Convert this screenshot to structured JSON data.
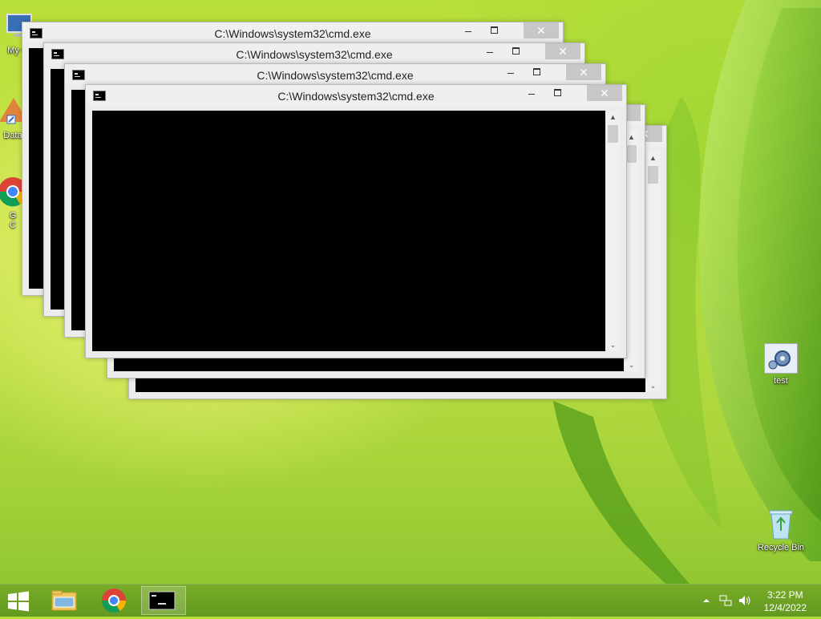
{
  "desktop": {
    "icons": [
      {
        "label": "My C",
        "name": "my-computer"
      },
      {
        "label": "Data",
        "name": "data-shortcut"
      },
      {
        "label": "G",
        "label2": "C",
        "name": "google-chrome"
      },
      {
        "label": "test",
        "name": "test"
      },
      {
        "label": "Recycle Bin",
        "name": "recycle-bin"
      }
    ]
  },
  "windows": [
    {
      "title": "C:\\Windows\\system32\\cmd.exe",
      "close_label": "✕"
    },
    {
      "title": "C:\\Windows\\system32\\cmd.exe",
      "close_label": "✕"
    },
    {
      "title": "C:\\Windows\\system32\\cmd.exe",
      "close_label": "✕"
    },
    {
      "title": "C:\\Windows\\system32\\cmd.exe",
      "close_label": "✕"
    },
    {
      "title": "",
      "close_label": "✕"
    },
    {
      "title": "",
      "close_label": "✕"
    }
  ],
  "taskbar": {
    "buttons": [
      {
        "name": "file-explorer",
        "active": false
      },
      {
        "name": "google-chrome",
        "active": false
      },
      {
        "name": "command-prompt",
        "active": true
      }
    ],
    "clock": {
      "time": "3:22 PM",
      "date": "12/4/2022"
    },
    "icons": {
      "tray": "show-hidden-icons",
      "network": "network-icon",
      "volume": "volume-icon"
    }
  },
  "colors": {
    "accent": "#8cc42f",
    "close_button": "#c7c7c7",
    "console": "#000000"
  }
}
